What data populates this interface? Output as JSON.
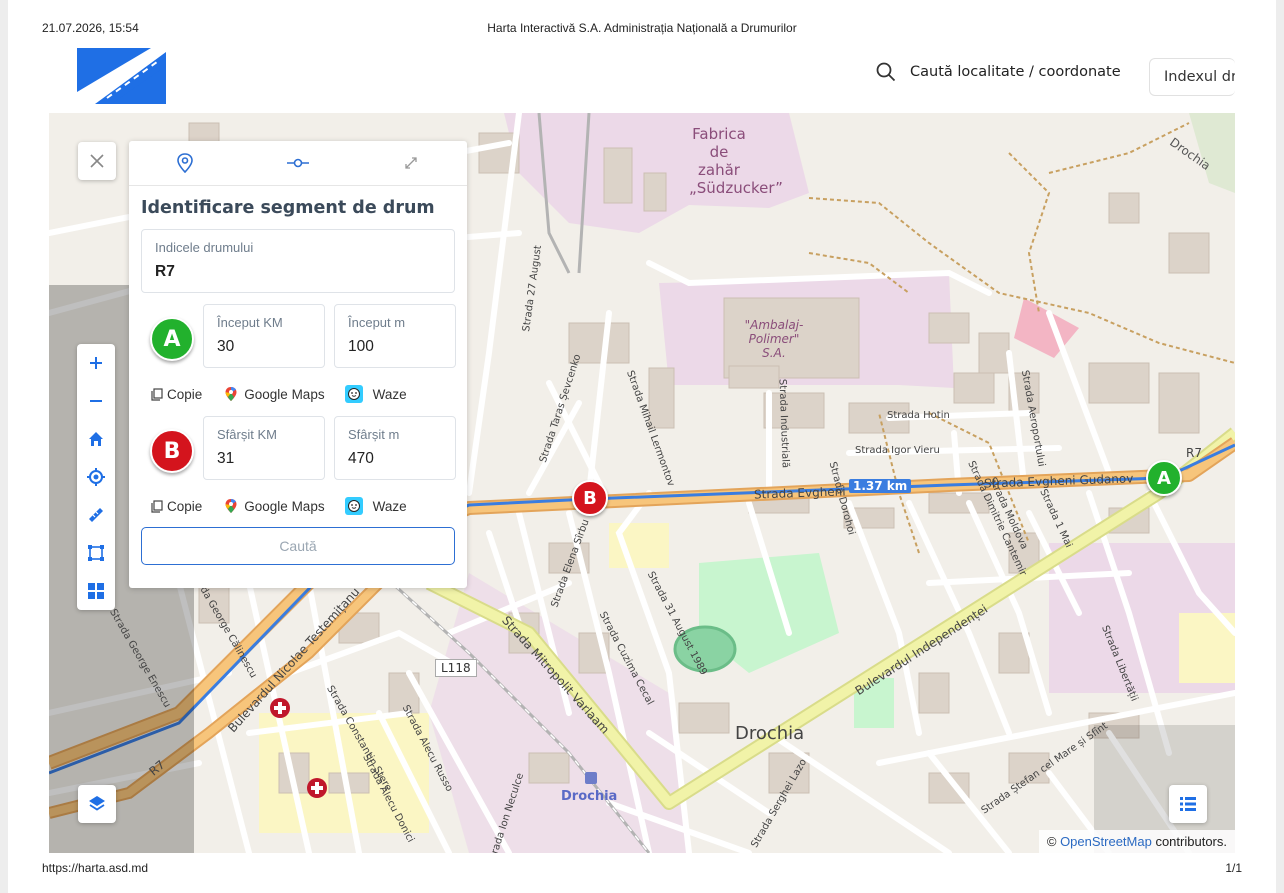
{
  "print_header": {
    "datetime": "21.07.2026, 15:54",
    "title": "Harta Interactivă S.A. Administrația Națională a Drumurilor"
  },
  "print_footer": {
    "url": "https://harta.asd.md",
    "page": "1/1"
  },
  "header": {
    "search_label": "Caută localitate / coordonate",
    "index_field": "Indexul dr"
  },
  "panel": {
    "title": "Identificare segment de drum",
    "road_index": {
      "label": "Indicele drumului",
      "value": "R7"
    },
    "start": {
      "badge": "A",
      "km_label": "Început KM",
      "km_value": "30",
      "m_label": "Început m",
      "m_value": "100"
    },
    "end": {
      "badge": "B",
      "km_label": "Sfârșit KM",
      "km_value": "31",
      "m_label": "Sfârșit m",
      "m_value": "470"
    },
    "link_copy": "Copie",
    "link_google": "Google Maps",
    "link_waze": "Waze",
    "search_button": "Caută"
  },
  "map": {
    "labels": {
      "factory": "Fabrica",
      "factory2": "de zahăr",
      "factory3": "„Südzucker”",
      "ambalaj1": "\"Ambalaj-",
      "ambalaj2": "Polimer\"",
      "ambalaj3": "S.A.",
      "city": "Drochia",
      "city_ne": "Drochia",
      "station": "Drochia",
      "road_l118": "L118",
      "road_r7_sw": "R7",
      "road_r7_ne": "R7",
      "street_gudanov": "Strada Evgheni Gudanov",
      "street_gudanov2": "Strada Evgheni",
      "distance": "1.37 km",
      "street_hotin": "Strada Hotin",
      "street_vieru": "Strada Igor Vieru",
      "street_independentei": "Bulevardul Independenței",
      "street_varlaam": "Strada Mitropolit Varlaam",
      "street_testemitanu": "Bulevardul Nicolae Testemițanu",
      "street_27aug": "Strada 27 August",
      "street_31aug": "Strada 31 August 1989",
      "street_industriala": "Strada Industrială",
      "street_lermontov": "Strada Mihail Lermontov",
      "street_cecal": "Strada Cuzima Cecal",
      "street_sirbu": "Strada Elena Sîrbu",
      "street_dorohoi": "Strada Dorohoi",
      "street_cantemir": "Strada Dimitrie Cantemir",
      "street_moldova": "Strada Moldova",
      "street_1mai": "Strada 1 Mai",
      "street_aeroportului": "Strada Aeroportului",
      "street_libertatii": "Strada Libertății",
      "street_stere": "Strada Constantin Stere",
      "street_russo": "Strada Alecu Russo",
      "street_donici": "Strada Alecu Donici",
      "street_necruce": "Strada Ion Neculce",
      "street_enescu": "Strada George Enescu",
      "street_calinescu": "Strada George Călinescu",
      "street_lazo": "Strada Serghei Lazo",
      "street_stefan": "Strada Ștefan cel Mare și Sfînt",
      "street_seicenko": "Strada Taras Șevcenko"
    },
    "markers": {
      "a": "A",
      "b": "B"
    },
    "attribution_prefix": "© ",
    "attribution_link": "OpenStreetMap",
    "attribution_suffix": " contributors."
  },
  "colors": {
    "route": "#3a7de0",
    "trunk": "#f7c57b",
    "secondary": "#f1f3a8",
    "marker_a": "#22b12d",
    "marker_b": "#d4141d",
    "accent": "#2d6fd3",
    "logo_blue": "#1f6fe5"
  },
  "icons": [
    "close-icon",
    "location-pin-icon",
    "route-segment-icon",
    "expand-icon",
    "plus-icon",
    "minus-icon",
    "home-icon",
    "crosshair-icon",
    "ruler-icon",
    "polygon-icon",
    "grid-icon",
    "layers-icon",
    "list-icon",
    "copy-icon",
    "google-maps-icon",
    "waze-icon",
    "search-icon"
  ]
}
